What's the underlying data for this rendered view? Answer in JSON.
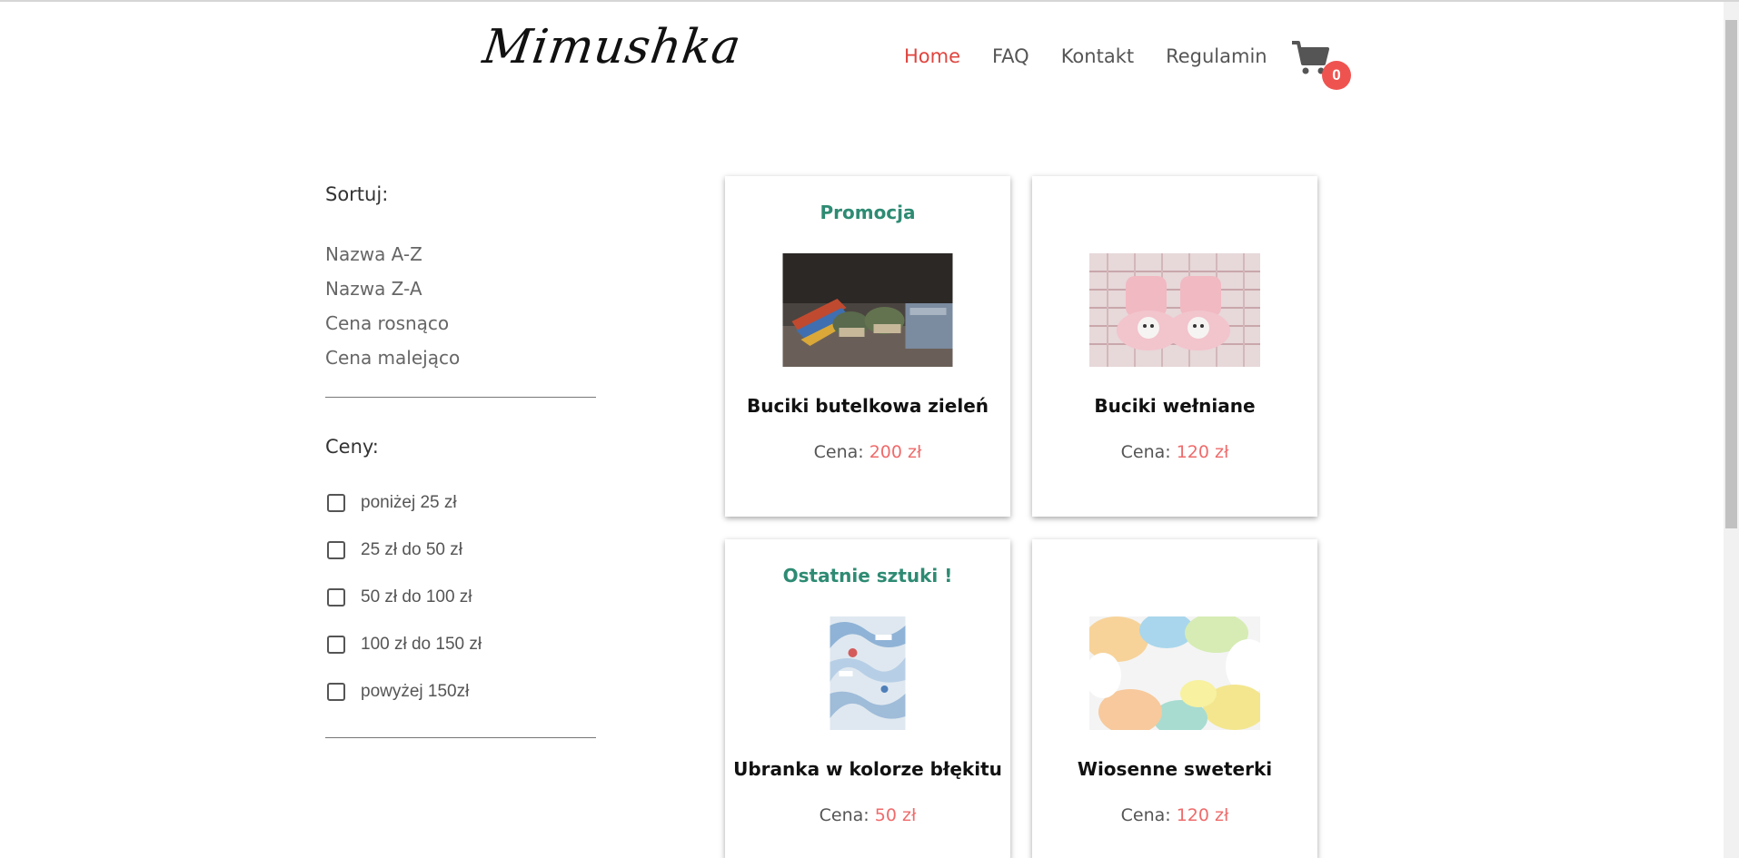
{
  "brand": {
    "logo_text": "Mimushka"
  },
  "nav": {
    "items": [
      {
        "label": "Home",
        "active": true
      },
      {
        "label": "FAQ",
        "active": false
      },
      {
        "label": "Kontakt",
        "active": false
      },
      {
        "label": "Regulamin",
        "active": false
      }
    ]
  },
  "cart": {
    "count": "0",
    "icon": "shopping-cart-icon"
  },
  "sidebar": {
    "sort_title": "Sortuj:",
    "sort_options": [
      "Nazwa A-Z",
      "Nazwa Z-A",
      "Cena rosnąco",
      "Cena malejąco"
    ],
    "price_title": "Ceny:",
    "price_filters": [
      "poniżej 25 zł",
      "25 zł do 50 zł",
      "50 zł do 100 zł",
      "100 zł do 150 zł",
      "powyżej 150zł"
    ]
  },
  "products": [
    {
      "badge": "Promocja",
      "name": "Buciki butelkowa zieleń",
      "price_label": "Cena:",
      "price": "200 zł",
      "image": "green-baby-shoes-photo"
    },
    {
      "badge": "",
      "name": "Buciki wełniane",
      "price_label": "Cena:",
      "price": "120 zł",
      "image": "pink-knitted-booties-photo"
    },
    {
      "badge": "Ostatnie sztuki !",
      "name": "Ubranka w kolorze błękitu",
      "price_label": "Cena:",
      "price": "50 zł",
      "image": "blue-clothes-photo"
    },
    {
      "badge": "",
      "name": "Wiosenne sweterki",
      "price_label": "Cena:",
      "price": "120 zł",
      "image": "pastel-sweaters-photo"
    }
  ],
  "colors": {
    "accent_red": "#e0443e",
    "badge_green": "#2e8b73",
    "price_red": "#ef6b6b",
    "cart_badge": "#ef5350"
  }
}
